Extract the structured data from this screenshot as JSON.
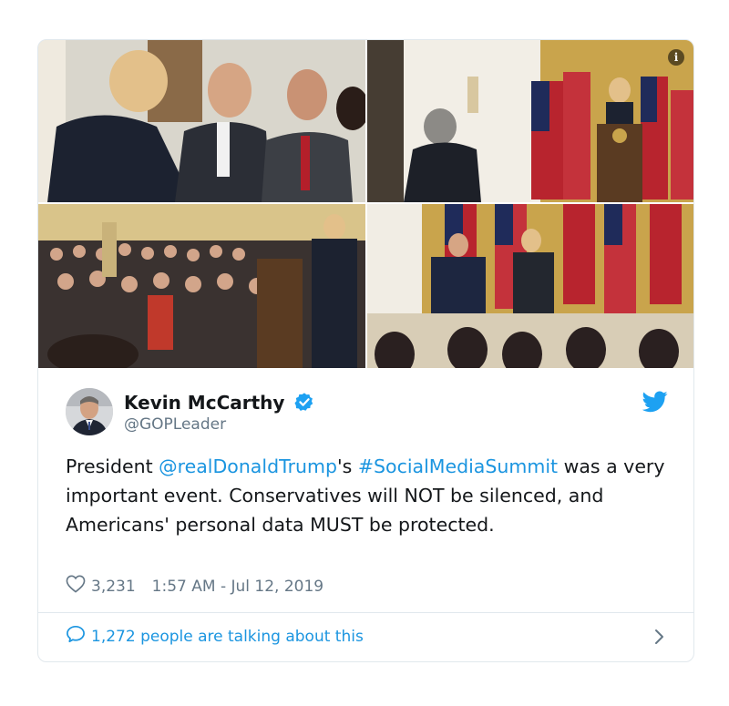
{
  "tweet": {
    "author_name": "Kevin McCarthy",
    "author_handle": "@GOPLeader",
    "text_prefix": "President ",
    "mention": "@realDonaldTrump",
    "text_mid": "'s ",
    "hashtag": "#SocialMediaSummit",
    "text_suffix": " was a very important event. Conservatives will NOT be silenced, and Americans' personal data MUST be protected.",
    "likes": "3,231",
    "timestamp": "1:57 AM - Jul 12, 2019",
    "talking": "1,272 people are talking about this"
  },
  "icons": {
    "info": "info-icon",
    "verified": "verified-badge-icon",
    "brand": "twitter-bird-icon",
    "like": "heart-icon",
    "reply": "speech-bubble-icon",
    "more": "chevron-right-icon"
  },
  "colors": {
    "link": "#1b95e0",
    "secondary_text": "#657786",
    "border": "#e1e8ed"
  }
}
